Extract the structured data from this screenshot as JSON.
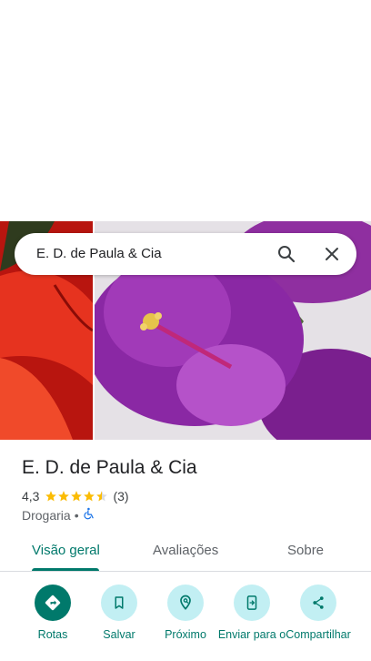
{
  "search": {
    "query": "E. D. de Paula & Cia"
  },
  "place": {
    "title": "E. D. de Paula & Cia",
    "rating": "4,3",
    "rating_value": 4.3,
    "reviews_count": "(3)",
    "category": "Drogaria",
    "separator": "•"
  },
  "tabs": [
    {
      "label": "Visão geral",
      "active": true
    },
    {
      "label": "Avaliações",
      "active": false
    },
    {
      "label": "Sobre",
      "active": false
    }
  ],
  "actions": [
    {
      "label": "Rotas",
      "icon": "directions-icon"
    },
    {
      "label": "Salvar",
      "icon": "bookmark-icon"
    },
    {
      "label": "Próximo",
      "icon": "nearby-icon"
    },
    {
      "label": "Enviar para o",
      "icon": "send-to-phone-icon"
    },
    {
      "label": "Compartilhar",
      "icon": "share-icon"
    }
  ],
  "colors": {
    "accent": "#00796b",
    "action_bg": "#c2eff3",
    "star": "#fbbc04"
  }
}
